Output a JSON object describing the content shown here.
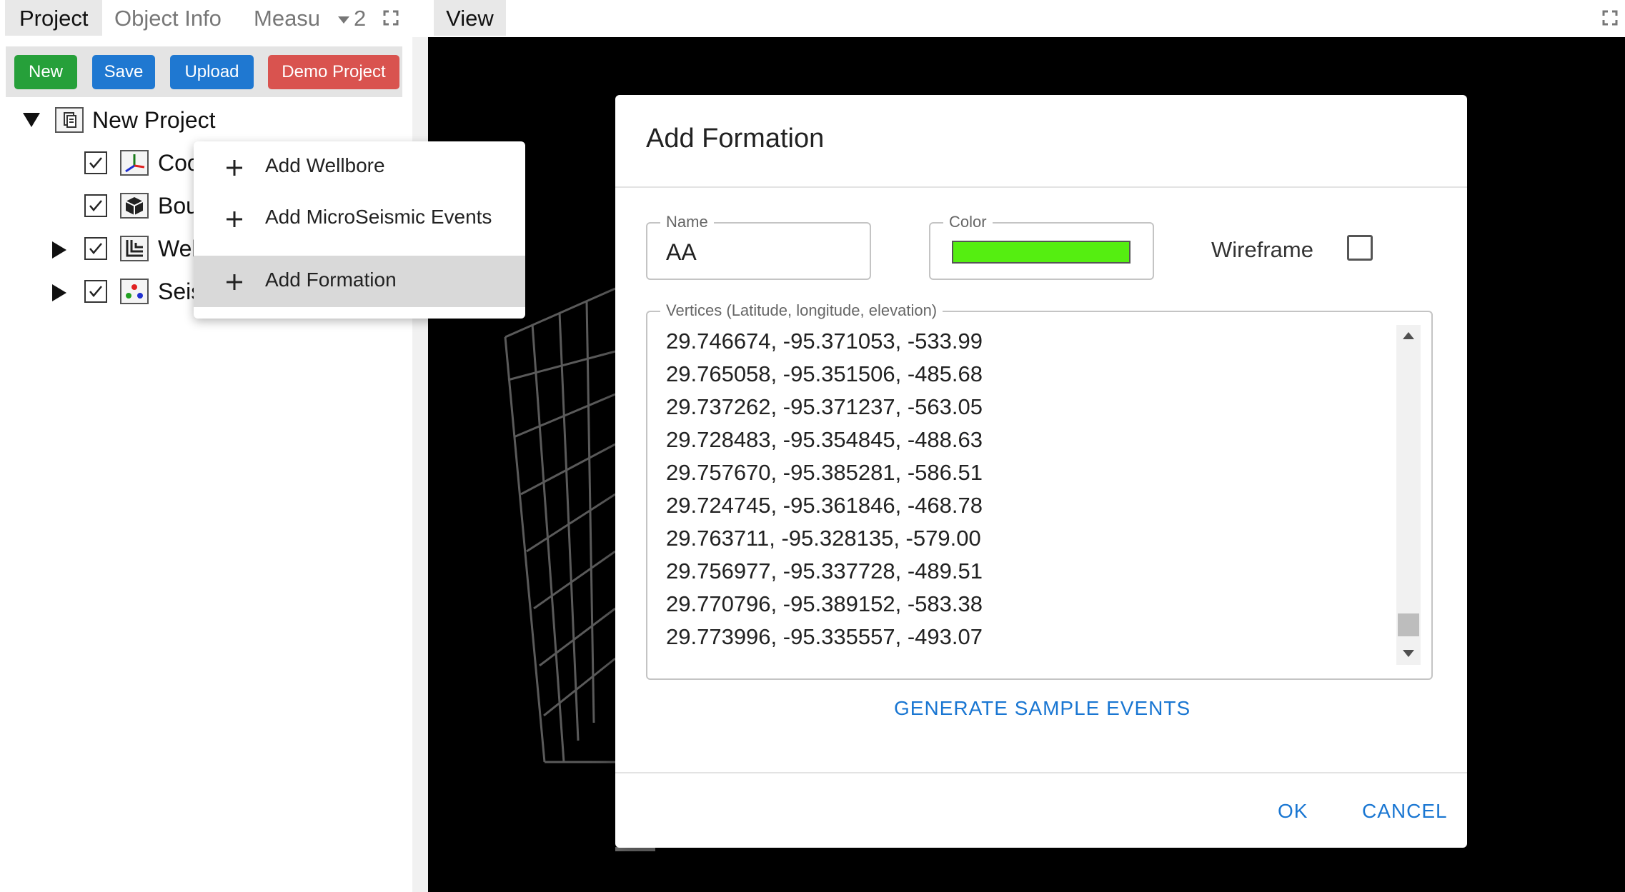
{
  "left_tabs": {
    "project": "Project",
    "object_info": "Object Info",
    "measure": "Measu",
    "overflow_count": "2"
  },
  "toolbar": {
    "new_label": "New",
    "save_label": "Save",
    "upload_label": "Upload",
    "demo_label": "Demo Project"
  },
  "tree": {
    "root_label": "New Project",
    "items": [
      {
        "label": "Coo",
        "checked": true,
        "icon": "axes-icon",
        "expandable": false
      },
      {
        "label": "Bou",
        "checked": true,
        "icon": "cube-icon",
        "expandable": false
      },
      {
        "label": "Wel",
        "checked": true,
        "icon": "wellbore-icon",
        "expandable": true
      },
      {
        "label": "Seis",
        "checked": true,
        "icon": "seismic-dots-icon",
        "expandable": true
      }
    ]
  },
  "context_menu": {
    "items": [
      {
        "label": "Add Wellbore",
        "selected": false
      },
      {
        "label": "Add MicroSeismic Events",
        "selected": false
      },
      {
        "label": "Add Formation",
        "selected": true
      }
    ]
  },
  "view": {
    "tab_label": "View"
  },
  "dialog": {
    "title": "Add Formation",
    "name_legend": "Name",
    "name_value": "AA",
    "color_legend": "Color",
    "color_value": "#55ee11",
    "wireframe_label": "Wireframe",
    "wireframe_checked": false,
    "vertices_legend": "Vertices (Latitude, longitude, elevation)",
    "vertices": [
      "29.746674, -95.371053, -533.99",
      "29.765058, -95.351506, -485.68",
      "29.737262, -95.371237, -563.05",
      "29.728483, -95.354845, -488.63",
      "29.757670, -95.385281, -586.51",
      "29.724745, -95.361846, -468.78",
      "29.763711, -95.328135, -579.00",
      "29.756977, -95.337728, -489.51",
      "29.770796, -95.389152, -583.38",
      "29.773996, -95.335557, -493.07"
    ],
    "generate_label": "GENERATE SAMPLE EVENTS",
    "ok_label": "OK",
    "cancel_label": "CANCEL"
  }
}
